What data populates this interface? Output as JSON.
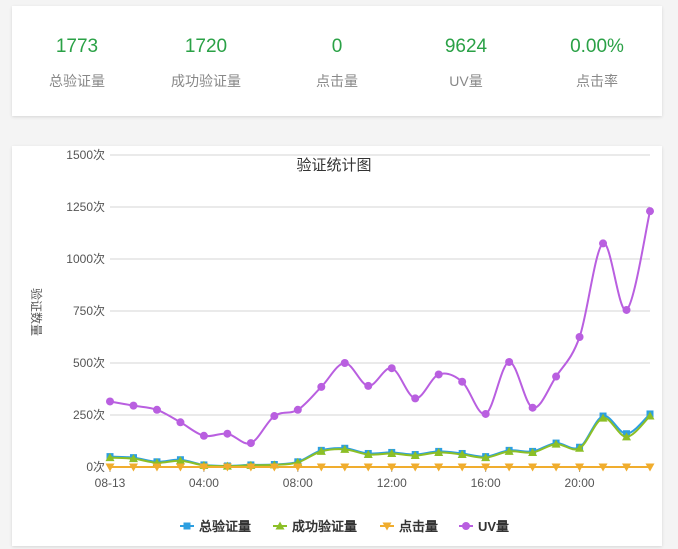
{
  "stats": [
    {
      "value": "1773",
      "label": "总验证量"
    },
    {
      "value": "1720",
      "label": "成功验证量"
    },
    {
      "value": "0",
      "label": "点击量"
    },
    {
      "value": "9624",
      "label": "UV量"
    },
    {
      "value": "0.00%",
      "label": "点击率"
    }
  ],
  "colors": {
    "stat_value": "#2aa146",
    "series": [
      "#2d9fe0",
      "#8cbf26",
      "#f0ad2e",
      "#b95fe0"
    ]
  },
  "chart_data": {
    "type": "line",
    "title": "验证统计图",
    "ylabel": "验证数量",
    "xlabel": "",
    "x_tick_labels": [
      "08-13",
      "04:00",
      "08:00",
      "12:00",
      "16:00",
      "20:00"
    ],
    "y_tick_labels": [
      "0次",
      "250次",
      "500次",
      "750次",
      "1000次",
      "1250次",
      "1500次"
    ],
    "ylim": [
      0,
      1500
    ],
    "grid": true,
    "legend_position": "bottom",
    "x": [
      "00:00",
      "01:00",
      "02:00",
      "03:00",
      "04:00",
      "05:00",
      "06:00",
      "07:00",
      "08:00",
      "09:00",
      "10:00",
      "11:00",
      "12:00",
      "13:00",
      "14:00",
      "15:00",
      "16:00",
      "17:00",
      "18:00",
      "19:00",
      "20:00",
      "21:00",
      "22:00",
      "23:00"
    ],
    "series": [
      {
        "name": "总验证量",
        "marker": "square",
        "values": [
          50,
          45,
          25,
          35,
          10,
          5,
          10,
          12,
          25,
          80,
          90,
          65,
          70,
          60,
          75,
          65,
          50,
          80,
          75,
          115,
          95,
          245,
          160,
          255
        ]
      },
      {
        "name": "成功验证量",
        "marker": "triangle",
        "values": [
          45,
          40,
          20,
          30,
          8,
          4,
          8,
          10,
          22,
          75,
          85,
          60,
          65,
          55,
          70,
          60,
          45,
          75,
          70,
          110,
          90,
          235,
          145,
          245
        ]
      },
      {
        "name": "点击量",
        "marker": "triangle-down",
        "values": [
          0,
          0,
          0,
          0,
          0,
          0,
          0,
          0,
          0,
          0,
          0,
          0,
          0,
          0,
          0,
          0,
          0,
          0,
          0,
          0,
          0,
          0,
          0,
          0
        ]
      },
      {
        "name": "UV量",
        "marker": "circle",
        "values": [
          315,
          295,
          275,
          215,
          150,
          160,
          115,
          245,
          275,
          385,
          500,
          390,
          475,
          330,
          445,
          410,
          255,
          505,
          285,
          435,
          625,
          1075,
          755,
          1230
        ]
      }
    ]
  }
}
